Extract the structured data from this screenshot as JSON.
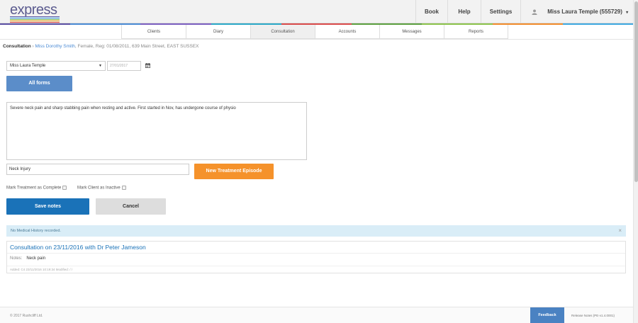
{
  "brand": {
    "logo_text": "express",
    "stripe_colors": [
      "#5a5aa6",
      "#2d8fd6",
      "#7ab648",
      "#e3a21a",
      "#d94040"
    ]
  },
  "header": {
    "buttons": [
      "Book",
      "Help",
      "Settings"
    ],
    "user_label": "Miss Laura Temple (555729)",
    "user_caret": "▾"
  },
  "rainbow_colors": [
    "#5a4fa3",
    "#4a8ad4",
    "#7b5ec0",
    "#2aa8c7",
    "#d94a4a",
    "#5a9e3e",
    "#8ac24a",
    "#f08a2a",
    "#3da8e0"
  ],
  "tabs": [
    {
      "label": "Clients",
      "active": false
    },
    {
      "label": "Diary",
      "active": false
    },
    {
      "label": "Consultation",
      "active": true
    },
    {
      "label": "Accounts",
      "active": false
    },
    {
      "label": "Messages",
      "active": false
    },
    {
      "label": "Reports",
      "active": false
    }
  ],
  "breadcrumb": {
    "root": "Consultation",
    "separator": "›",
    "client_name": "Miss Dorothy Smith",
    "client_details": ", Female, Reg: 01/08/2011, 639 Main Street, EAST SUSSEX"
  },
  "form": {
    "practitioner_select": "Miss Laura Temple",
    "date_value": "27/01/2017",
    "all_forms_label": "All forms",
    "notes_text": "Severe neck pain and sharp stabbing pain when resting and active. First started in Nov, has undergone course of physio",
    "episode_value": "Neck Injury",
    "new_episode_label": "New Treatment Episode",
    "mark_complete_label": "Mark Treatment as Complete",
    "mark_inactive_label": "Mark Client as Inactive",
    "save_label": "Save notes",
    "cancel_label": "Cancel"
  },
  "alert": {
    "text": "No Medical History recorded.",
    "close": "×"
  },
  "history": {
    "title": "Consultation on 23/11/2016 with Dr Peter Jameson",
    "notes_label": "Notes:",
    "notes_value": "Neck pain",
    "meta": "Added: C4 23/11/2016 10:19:34 Modified: / /"
  },
  "footer": {
    "copyright": "© 2017 Rushcliff Ltd.",
    "feedback_label": "Feedback",
    "release_label": "Release Notes (PE-v1.4.0001)"
  }
}
